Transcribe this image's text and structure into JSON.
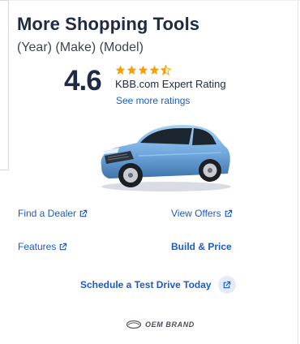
{
  "card": {
    "title": "More Shopping Tools",
    "subtitle": "(Year) (Make) (Model)"
  },
  "rating": {
    "score": "4.6",
    "stars_value": 4.5,
    "stars_max": 5,
    "label": "KBB.com Expert Rating",
    "see_more": "See more ratings"
  },
  "vehicle_image": {
    "icon": "car-image",
    "color": "#7fb3e6"
  },
  "links": {
    "find_dealer": "Find a Dealer",
    "view_offers": "View Offers",
    "features": "Features",
    "build_price": "Build & Price",
    "schedule_test_drive": "Schedule a Test Drive Today"
  },
  "brand": {
    "name": "OEM BRAND"
  },
  "colors": {
    "accent": "#1a5cc7",
    "star": "#f4a100",
    "title": "#1f2a44"
  }
}
